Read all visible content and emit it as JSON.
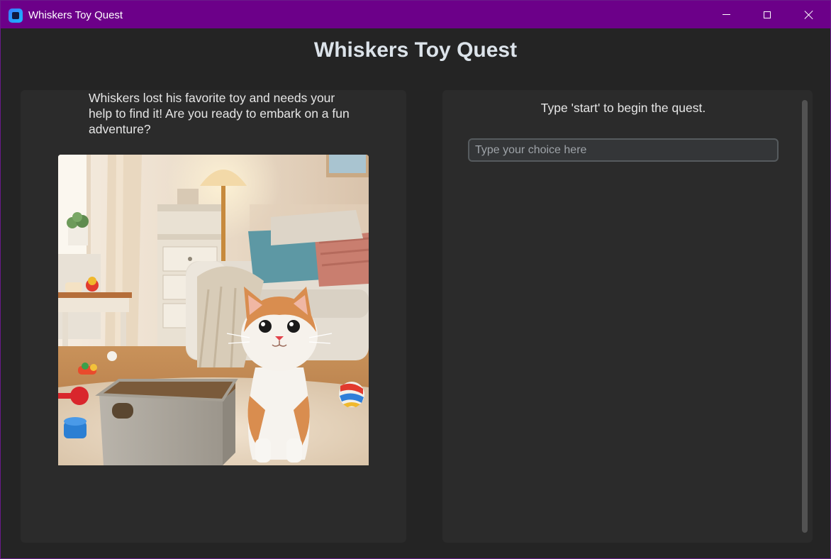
{
  "window": {
    "title": "Whiskers Toy Quest",
    "accent": "#6c0089"
  },
  "main": {
    "heading": "Whiskers Toy Quest"
  },
  "story_panel": {
    "text": "Whiskers lost his favorite toy and needs your help to find it! Are you ready to embark on a fun adventure?",
    "image_description_icon": "kitten-living-room-image"
  },
  "input_panel": {
    "prompt": "Type 'start' to begin the quest.",
    "input_placeholder": "Type your choice here",
    "input_value": ""
  }
}
